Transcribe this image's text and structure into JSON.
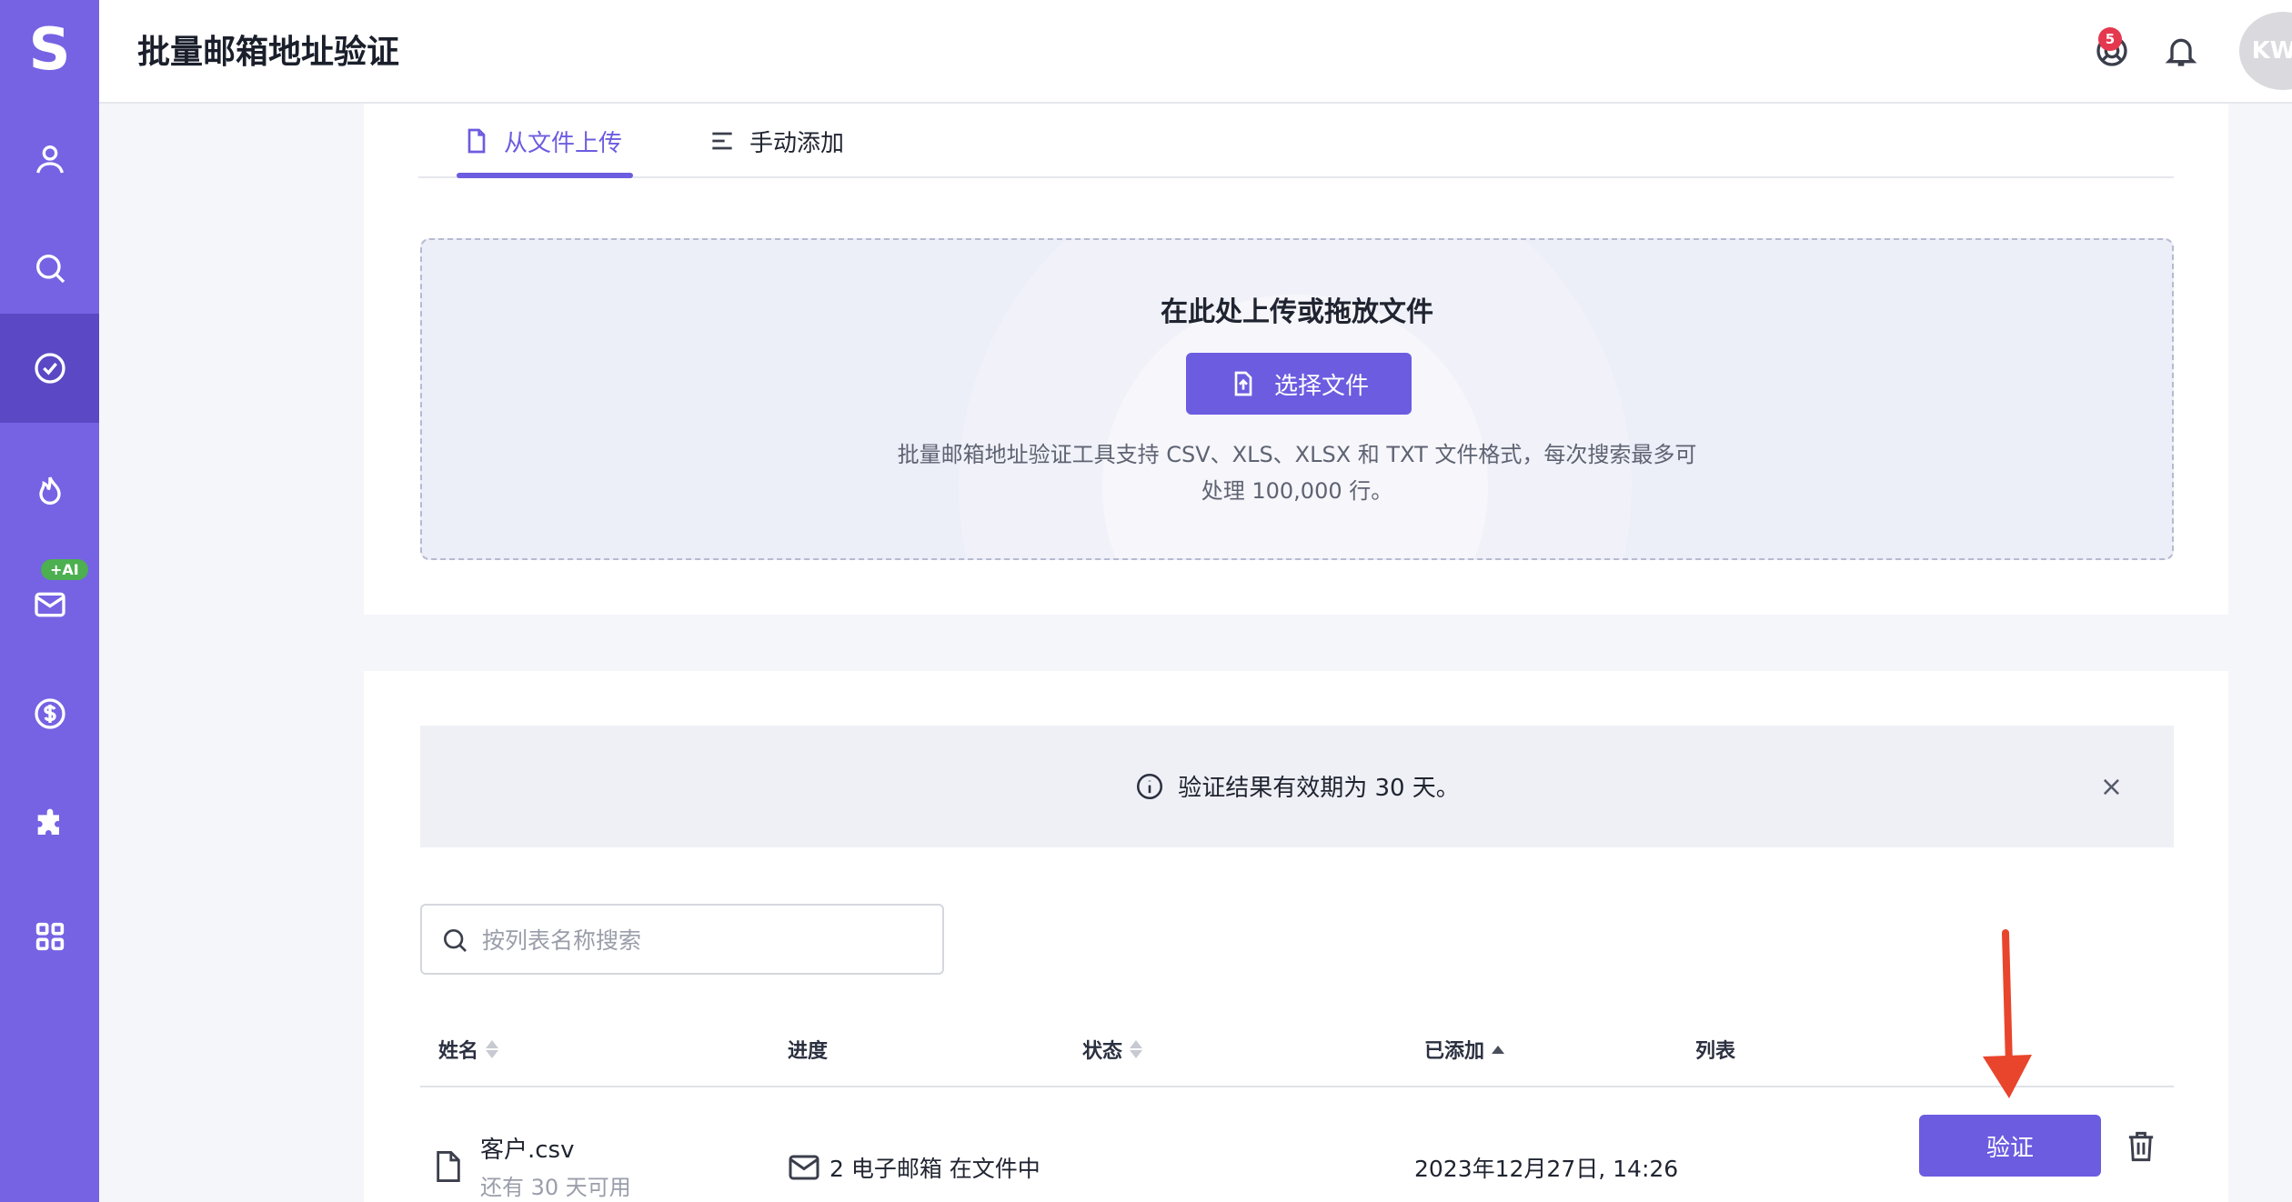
{
  "app": {
    "logo": "S",
    "title": "批量邮箱地址验证"
  },
  "sidebar": {
    "items": [
      {
        "icon": "user-icon"
      },
      {
        "icon": "search-icon"
      },
      {
        "icon": "check-circle-icon",
        "active": true
      },
      {
        "icon": "flame-icon"
      },
      {
        "icon": "mail-icon",
        "badge": "+AI"
      },
      {
        "icon": "dollar-icon"
      },
      {
        "icon": "puzzle-icon"
      },
      {
        "icon": "grid-icon"
      }
    ]
  },
  "header": {
    "notification_count": "5",
    "avatar_initials": "KW"
  },
  "tabs": [
    {
      "label": "从文件上传",
      "icon": "file-icon",
      "active": true
    },
    {
      "label": "手动添加",
      "icon": "list-icon",
      "active": false
    }
  ],
  "upload": {
    "title": "在此处上传或拖放文件",
    "button_label": "选择文件",
    "description_line1": "批量邮箱地址验证工具支持 CSV、XLS、XLSX 和 TXT 文件格式，每次搜索最多可",
    "description_line2": "处理 100,000 行。"
  },
  "notice": {
    "text": "验证结果有效期为 30 天。",
    "close": "×"
  },
  "search": {
    "placeholder": "按列表名称搜索",
    "value": ""
  },
  "table": {
    "headers": {
      "name": "姓名",
      "progress": "进度",
      "status": "状态",
      "added": "已添加",
      "list": "列表"
    },
    "rows": [
      {
        "name": "客户.csv",
        "subtitle": "还有 30 天可用",
        "progress": "2 电子邮箱 在文件中",
        "status": "",
        "added": "2023年12月27日, 14:26",
        "action": "验证"
      }
    ]
  },
  "colors": {
    "accent": "#6c5ce0",
    "sidebar": "#7563e4",
    "sidebar_active": "#5a48c4",
    "badge_red": "#e5384f",
    "ai_green": "#4caf50",
    "arrow": "#e8452c"
  }
}
